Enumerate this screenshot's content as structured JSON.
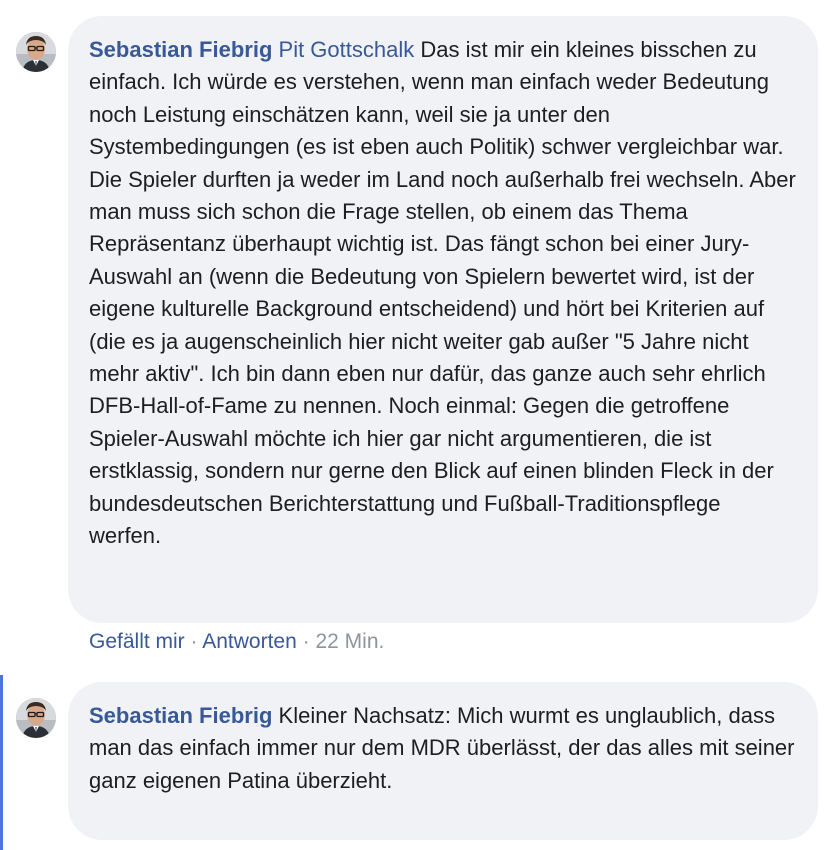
{
  "comments": [
    {
      "author": "Sebastian Fiebrig",
      "mention": "Pit Gottschalk",
      "text": "Das ist mir ein kleines bisschen zu einfach. Ich würde es verstehen, wenn man einfach weder Bedeutung noch Leistung einschätzen kann, weil sie ja unter den Systembedingungen (es ist eben auch Politik) schwer vergleichbar war. Die Spieler durften ja weder im Land noch außerhalb frei wechseln. Aber man muss sich schon die Frage stellen, ob einem das Thema Repräsentanz überhaupt wichtig ist. Das fängt schon bei einer Jury-Auswahl an (wenn die Bedeutung von Spielern bewertet wird, ist der eigene kulturelle Background entscheidend) und hört bei Kriterien auf (die es ja augenscheinlich hier nicht weiter gab außer \"5 Jahre nicht mehr aktiv\". Ich bin dann eben nur dafür, das ganze auch sehr ehrlich DFB-Hall-of-Fame zu nennen. Noch einmal: Gegen die getroffene Spieler-Auswahl möchte ich hier gar nicht argumentieren, die ist erstklassig, sondern nur gerne den Blick auf einen blinden Fleck in der bundesdeutschen Berichterstattung und Fußball-Traditionspflege werfen.",
      "like_label": "Gefällt mir",
      "reply_label": "Antworten",
      "separator": "·",
      "time": "22 Min."
    },
    {
      "author": "Sebastian Fiebrig",
      "text": "Kleiner Nachsatz: Mich wurmt es unglaublich, dass man das einfach immer nur dem MDR überlässt, der das alles mit seiner ganz eigenen Patina überzieht."
    }
  ],
  "colors": {
    "link": "#385898",
    "bubble": "#f0f2f5",
    "meta": "#8d949e",
    "thread_line": "#4a76d6"
  }
}
